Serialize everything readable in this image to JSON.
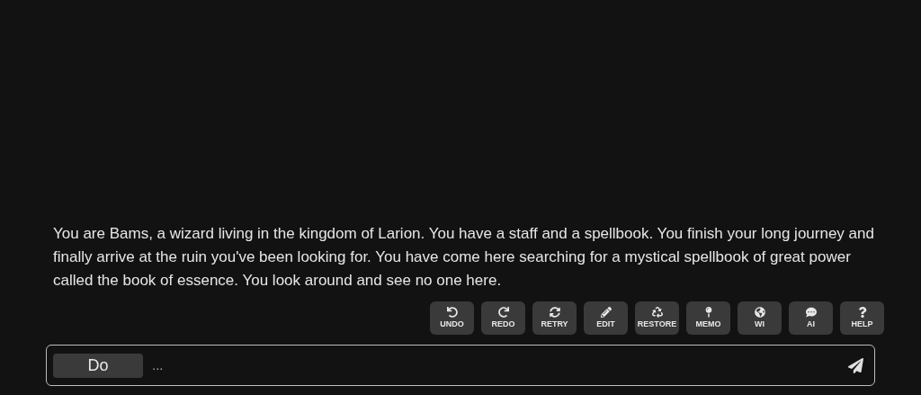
{
  "story": {
    "text": "You are Bams, a wizard living in the kingdom of Larion. You have a staff and a spellbook. You finish your long journey and finally arrive at the ruin you've been looking for. You have come here searching for a mystical spellbook of great power called the book of essence. You look around and see no one here."
  },
  "actions": [
    {
      "kind": "undo",
      "label": "UNDO"
    },
    {
      "kind": "redo",
      "label": "REDO"
    },
    {
      "kind": "retry",
      "label": "RETRY"
    },
    {
      "kind": "edit",
      "label": "EDIT"
    },
    {
      "kind": "restore",
      "label": "RESTORE"
    },
    {
      "kind": "memo",
      "label": "MEMO"
    },
    {
      "kind": "wi",
      "label": "WI"
    },
    {
      "kind": "ai",
      "label": "AI"
    },
    {
      "kind": "help",
      "label": "HELP"
    }
  ],
  "input": {
    "mode": "Do",
    "placeholder": "..."
  }
}
